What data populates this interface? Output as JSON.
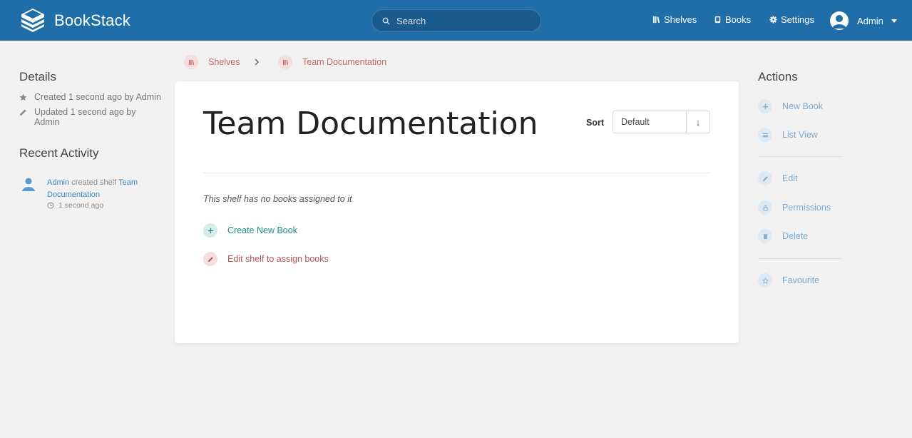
{
  "app": {
    "name": "BookStack"
  },
  "header": {
    "search_placeholder": "Search",
    "nav": {
      "shelves": "Shelves",
      "books": "Books",
      "settings": "Settings"
    },
    "user": "Admin"
  },
  "breadcrumbs": [
    "Shelves",
    "Team Documentation"
  ],
  "details": {
    "title": "Details",
    "created": "Created 1 second ago by Admin",
    "updated_line1": "Updated 1 second ago by",
    "updated_line2": "Admin"
  },
  "recent": {
    "title": "Recent Activity",
    "user": "Admin",
    "action": " created shelf ",
    "target_line1": "Team",
    "target_line2": "Documentation",
    "time": "1 second ago"
  },
  "shelf": {
    "title": "Team Documentation",
    "sort_label": "Sort",
    "sort_value": "Default",
    "sort_dir": "↓",
    "empty_text": "This shelf has no books assigned to it",
    "create_book": "Create New Book",
    "edit_shelf": "Edit shelf to assign books"
  },
  "actions": {
    "title": "Actions",
    "new_book": "New Book",
    "list_view": "List View",
    "edit": "Edit",
    "permissions": "Permissions",
    "delete": "Delete",
    "favourite": "Favourite"
  },
  "colors": {
    "header": "#206ea7",
    "shelf_accent": "#c46a6a",
    "book_accent": "#1f8b7e",
    "link": "#3b87c5"
  }
}
